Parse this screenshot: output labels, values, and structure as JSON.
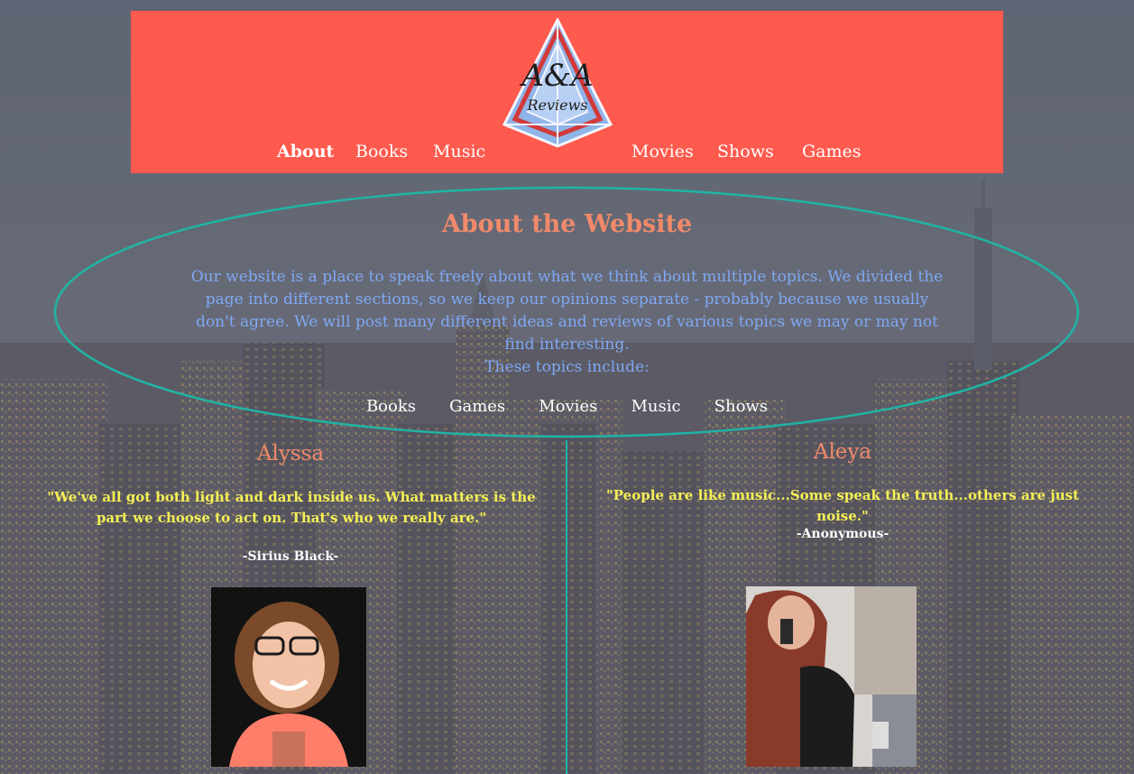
{
  "logo": {
    "line1": "A&A",
    "line2": "Reviews"
  },
  "nav": {
    "left": [
      "About",
      "Books",
      "Music"
    ],
    "right": [
      "Movies",
      "Shows",
      "Games"
    ]
  },
  "about": {
    "title": "About the Website",
    "body": "Our website is a place to speak freely about what we think about multiple topics. We divided the page into different sections, so we keep our opinions separate - probably because we usually don't agree. We will post many different ideas and reviews of various topics we may or may not find interesting.",
    "topics_intro": "These topics include:",
    "topics": [
      "Books",
      "Games",
      "Movies",
      "Music",
      "Shows"
    ]
  },
  "people": [
    {
      "name": "Alyssa",
      "quote": "\"We've all got both light and dark inside us. What matters is the part we choose to act on. That's who we really are.\"",
      "attribution": "-Sirius Black-"
    },
    {
      "name": "Aleya",
      "quote": "\"People are like music...Some speak the truth...others are just noise.\"",
      "attribution": "-Anonymous-"
    }
  ],
  "colors": {
    "header": "#ff5a4e",
    "accent": "#1fb5a6",
    "title": "#f08a6a",
    "body_text": "#7fa8f5",
    "quote": "#f5f055"
  }
}
